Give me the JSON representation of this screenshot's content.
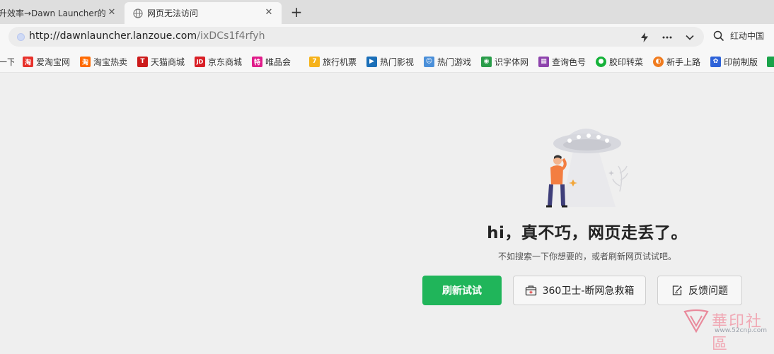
{
  "tabs": [
    {
      "title": "升效率→Dawn Launcher的",
      "close": "✕",
      "active": false
    },
    {
      "title": "网页无法访问",
      "close": "✕",
      "active": true
    }
  ],
  "new_tab_label": "+",
  "address": {
    "host": "http://dawnlauncher.lanzoue.com",
    "path": "/ixDCs1f4rfyh",
    "search_text": "红动中国"
  },
  "bookmarks": [
    {
      "label": "一下",
      "icon": "",
      "color": "#f7f7f7"
    },
    {
      "label": "爱淘宝网",
      "icon": "淘",
      "color": "#e7312b"
    },
    {
      "label": "淘宝热卖",
      "icon": "淘",
      "color": "#ff6a00"
    },
    {
      "label": "天猫商城",
      "icon": "T",
      "color": "#cc1b1b"
    },
    {
      "label": "京东商城",
      "icon": "JD",
      "color": "#d91f26"
    },
    {
      "label": "唯品会",
      "icon": "特",
      "color": "#e01c8a"
    },
    {
      "label": "旅行机票",
      "icon": "7",
      "color": "#f6b21a"
    },
    {
      "label": "热门影视",
      "icon": "▶",
      "color": "#1b6fb8"
    },
    {
      "label": "热门游戏",
      "icon": "☺",
      "color": "#4a8fd9"
    },
    {
      "label": "识字体网",
      "icon": "◉",
      "color": "#2a9d4a"
    },
    {
      "label": "查询色号",
      "icon": "▦",
      "color": "#8e44ad"
    },
    {
      "label": "胶印转菜",
      "icon": "●",
      "color": "#16b23a"
    },
    {
      "label": "新手上路",
      "icon": "◐",
      "color": "#f07b1e"
    },
    {
      "label": "印前制版",
      "icon": "✿",
      "color": "#2d62d8"
    },
    {
      "label": "",
      "icon": "",
      "color": "#1aa34a"
    }
  ],
  "error": {
    "headline": "hi，真不巧，网页走丢了。",
    "subline": "不如搜索一下你想要的，或者刷新网页试试吧。",
    "retry_label": "刷新试试",
    "guard_label": "360卫士-断网急救箱",
    "feedback_label": "反馈问题"
  },
  "watermark": {
    "text": "華印社區",
    "url": "www.52cnp.com"
  },
  "colors": {
    "primary": "#20b55a",
    "tabbar": "#dedede",
    "background": "#efefef"
  }
}
